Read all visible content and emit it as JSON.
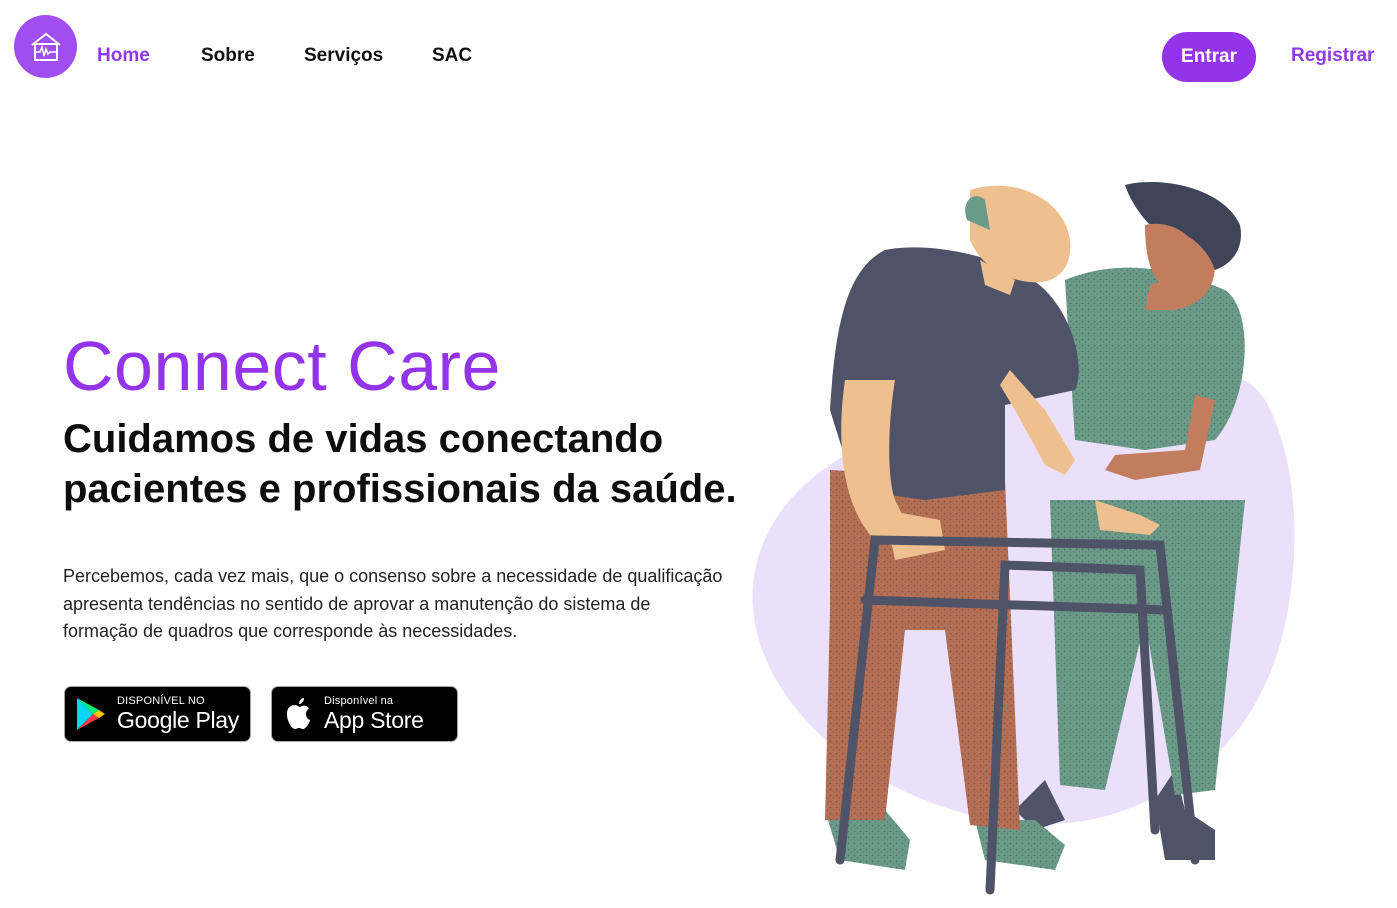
{
  "header": {
    "nav": [
      {
        "label": "Home",
        "active": true
      },
      {
        "label": "Sobre",
        "active": false
      },
      {
        "label": "Serviços",
        "active": false
      },
      {
        "label": "SAC",
        "active": false
      }
    ],
    "login_label": "Entrar",
    "register_label": "Registrar"
  },
  "hero": {
    "brand": "Connect Care",
    "headline": "Cuidamos de vidas conectando pacientes e profissionais da saúde.",
    "description": "Percebemos, cada vez mais, que o consenso sobre a necessidade de qualificação apresenta tendências no sentido de aprovar a manutenção do sistema de formação de quadros que corresponde às necessidades.",
    "stores": {
      "google": {
        "small": "DISPONÍVEL NO",
        "big": "Google Play",
        "icon": "google-play-icon"
      },
      "apple": {
        "small": "Disponível na",
        "big": "App Store",
        "icon": "apple-icon"
      }
    }
  },
  "colors": {
    "accent": "#9333ea",
    "logo_bg": "#a14ef0",
    "blob": "#ebe0fb"
  }
}
